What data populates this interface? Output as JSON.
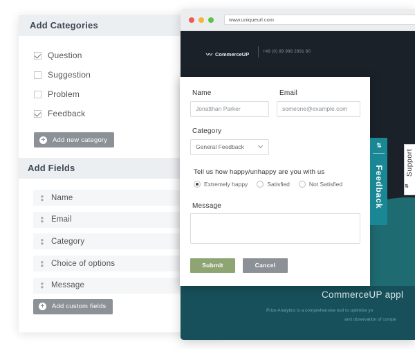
{
  "builder": {
    "categories_header": "Add Categories",
    "categories": [
      {
        "label": "Question",
        "checked": true
      },
      {
        "label": "Suggestion",
        "checked": false
      },
      {
        "label": "Problem",
        "checked": false
      },
      {
        "label": "Feedback",
        "checked": true
      }
    ],
    "add_category_label": "Add new category",
    "fields_header": "Add Fields",
    "fields": [
      "Name",
      "Email",
      "Category",
      "Choice of options",
      "Message"
    ],
    "add_field_label": "Add custom fields"
  },
  "browser": {
    "url": "www.uniqueurl.com",
    "dot_colors": [
      "#ee5b52",
      "#f3b53a",
      "#5cc443"
    ]
  },
  "site": {
    "logo": "CommerceUP",
    "phone": "+49 (0) 89 998 2991 80",
    "hero_title": "CommerceUP appl",
    "hero_sub1": "Price Analytics is a comprehensive tool to optimize yo",
    "hero_sub2": "and observation of compe"
  },
  "form": {
    "name_label": "Name",
    "name_value": "Jonatthan Parker",
    "email_label": "Email",
    "email_placeholder": "someone@example.com",
    "category_label": "Category",
    "category_value": "General Feedback",
    "happy_label": "Tell us how happy/unhappy are you with us",
    "options": [
      {
        "label": "Extremely happy",
        "selected": true
      },
      {
        "label": "Satisfied",
        "selected": false
      },
      {
        "label": "Not Satisfied",
        "selected": false
      }
    ],
    "message_label": "Message",
    "submit_label": "Submit",
    "cancel_label": "Cancel"
  },
  "tabs": {
    "feedback_label": "Feedback",
    "support_label": "Support",
    "tab_icon": "⇅"
  },
  "colors": {
    "accent_teal": "#1a8795",
    "submit_green": "#8ea473",
    "button_gray": "#8b9196"
  }
}
